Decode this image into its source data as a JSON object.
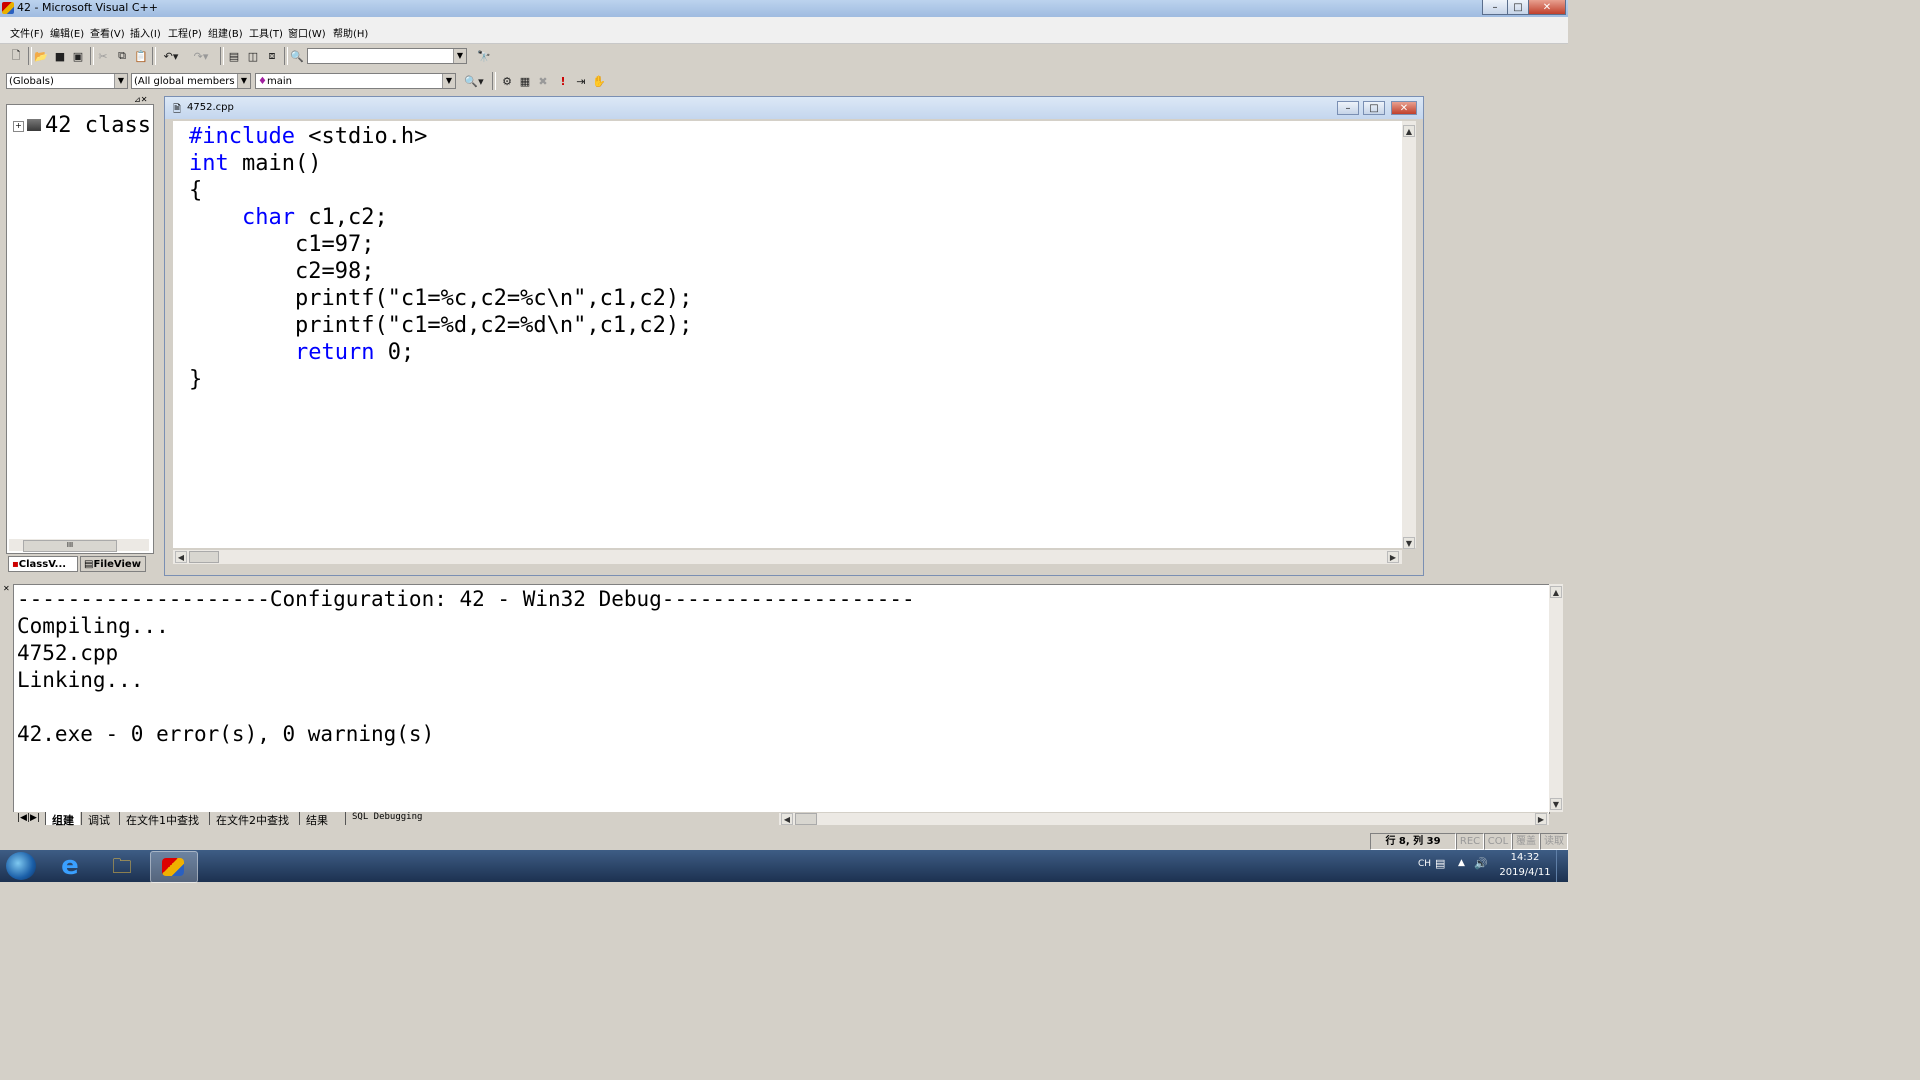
{
  "window": {
    "title": "42 - Microsoft Visual C++",
    "minimize_glyph": "–",
    "maximize_glyph": "□",
    "close_glyph": "✕"
  },
  "menu": [
    "文件(F)",
    "编辑(E)",
    "查看(V)",
    "插入(I)",
    "工程(P)",
    "组建(B)",
    "工具(T)",
    "窗口(W)",
    "帮助(H)"
  ],
  "wizardbar": {
    "scope": "(Globals)",
    "members": "(All global members",
    "function": "main"
  },
  "workspace": {
    "tree_item": "42 class",
    "tabs": [
      "ClassV...",
      "FileView"
    ]
  },
  "editor": {
    "title": "4752.cpp",
    "lines": [
      {
        "indent": "",
        "kw": "#include",
        "rest": " <stdio.h>"
      },
      {
        "indent": "",
        "kw": "int",
        "rest": " main()"
      },
      {
        "indent": "",
        "kw": "",
        "rest": "{"
      },
      {
        "indent": "    ",
        "kw": "char",
        "rest": " c1,c2;"
      },
      {
        "indent": "        ",
        "kw": "",
        "rest": "c1=97;"
      },
      {
        "indent": "        ",
        "kw": "",
        "rest": "c2=98;"
      },
      {
        "indent": "        ",
        "kw": "",
        "rest": "printf(\"c1=%c,c2=%c\\n\",c1,c2);"
      },
      {
        "indent": "        ",
        "kw": "",
        "rest": "printf(\"c1=%d,c2=%d\\n\",c1,c2);"
      },
      {
        "indent": "        ",
        "kw": "return",
        "rest": " 0;"
      },
      {
        "indent": "",
        "kw": "",
        "rest": "}"
      }
    ]
  },
  "output": {
    "lines": [
      "--------------------Configuration: 42 - Win32 Debug--------------------",
      "Compiling...",
      "4752.cpp",
      "Linking...",
      "",
      "42.exe - 0 error(s), 0 warning(s)"
    ],
    "tabs": [
      "组建",
      "调试",
      "在文件1中查找",
      "在文件2中查找",
      "结果",
      "SQL Debugging"
    ]
  },
  "status": {
    "position": "行 8, 列 39",
    "indicators": [
      "REC",
      "COL",
      "覆盖",
      "读取"
    ]
  },
  "taskbar": {
    "lang": "CH",
    "time": "14:32",
    "date": "2019/4/11"
  },
  "colors": {
    "keyword": "#0000ff",
    "editor_bg": "#ffffff",
    "chrome": "#d4d0c8"
  }
}
